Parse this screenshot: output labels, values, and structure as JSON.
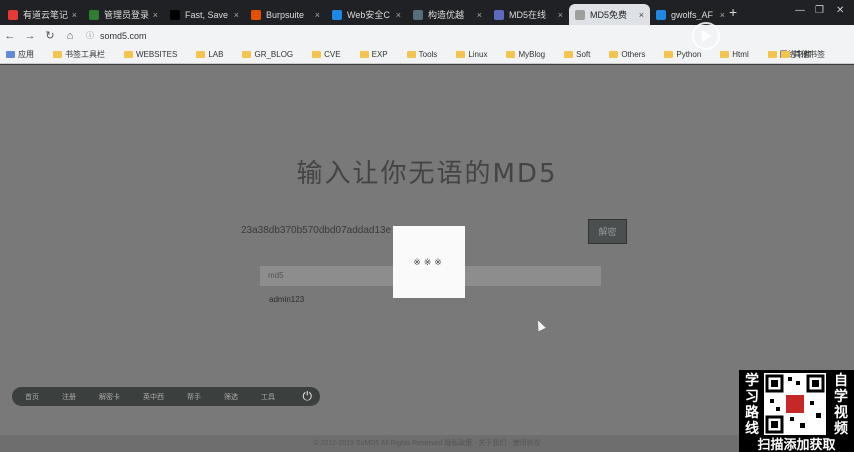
{
  "browser": {
    "tabs": [
      {
        "label": "有道云笔记",
        "color": "#e53935"
      },
      {
        "label": "管理员登录",
        "color": "#2e7d32"
      },
      {
        "label": "Fast, Save",
        "color": "#000000"
      },
      {
        "label": "Burpsuite",
        "color": "#e65100"
      },
      {
        "label": "Web安全C",
        "color": "#1e88e5"
      },
      {
        "label": "构造优越",
        "color": "#546e7a"
      },
      {
        "label": "MD5在线",
        "color": "#5c6bc0"
      },
      {
        "label": "MD5免费",
        "color": "#9e9e9e"
      },
      {
        "label": "gwolfs_AF",
        "color": "#1e88e5"
      }
    ],
    "close_glyph": "×",
    "new_tab_glyph": "+",
    "url": "somd5.com",
    "bookmarks": [
      {
        "label": "应用",
        "folder": false
      },
      {
        "label": "书签工具栏",
        "folder": true
      },
      {
        "label": "WEBSITES",
        "folder": true
      },
      {
        "label": "LAB",
        "folder": true
      },
      {
        "label": "GR_BLOG",
        "folder": true
      },
      {
        "label": "CVE",
        "folder": true
      },
      {
        "label": "EXP",
        "folder": true
      },
      {
        "label": "Tools",
        "folder": true
      },
      {
        "label": "Linux",
        "folder": true
      },
      {
        "label": "MyBlog",
        "folder": true
      },
      {
        "label": "Soft",
        "folder": true
      },
      {
        "label": "Others",
        "folder": true
      },
      {
        "label": "Python",
        "folder": true
      },
      {
        "label": "Html",
        "folder": true
      },
      {
        "label": "网络书籍",
        "folder": true
      }
    ],
    "other_bookmarks": "其他书签"
  },
  "page": {
    "headline": "输入让你无语的MD5",
    "hash_value": "23a38db370b570dbd07addad13e",
    "decrypt_label": "解密",
    "result_bar_text": "md5",
    "result_text": "admin123",
    "loading_text": "※※※",
    "bottom_nav": [
      "首页",
      "注册",
      "解密卡",
      "英中西",
      "帮手",
      "筛选",
      "工具"
    ],
    "footer_text": "© 2012-2019 SoMD5 All Rights Reserved 隐私政策 · 关于我们 · 使用协议"
  },
  "watermark": {
    "left_text": "学习路线",
    "right_text": "自学视频",
    "bottom_text": "扫描添加获取"
  }
}
